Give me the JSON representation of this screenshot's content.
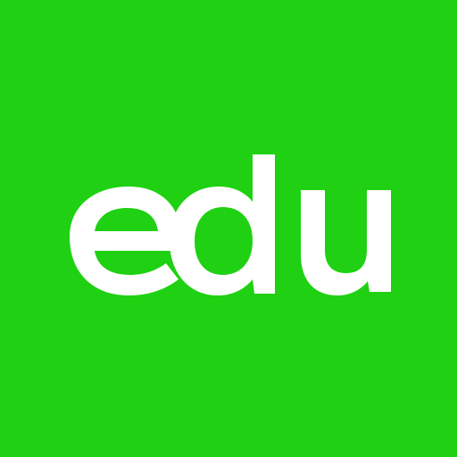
{
  "logo": {
    "text": "edu",
    "letters": [
      "e",
      "d",
      "u"
    ],
    "background_color": "#1fd112",
    "text_color": "#ffffff"
  }
}
